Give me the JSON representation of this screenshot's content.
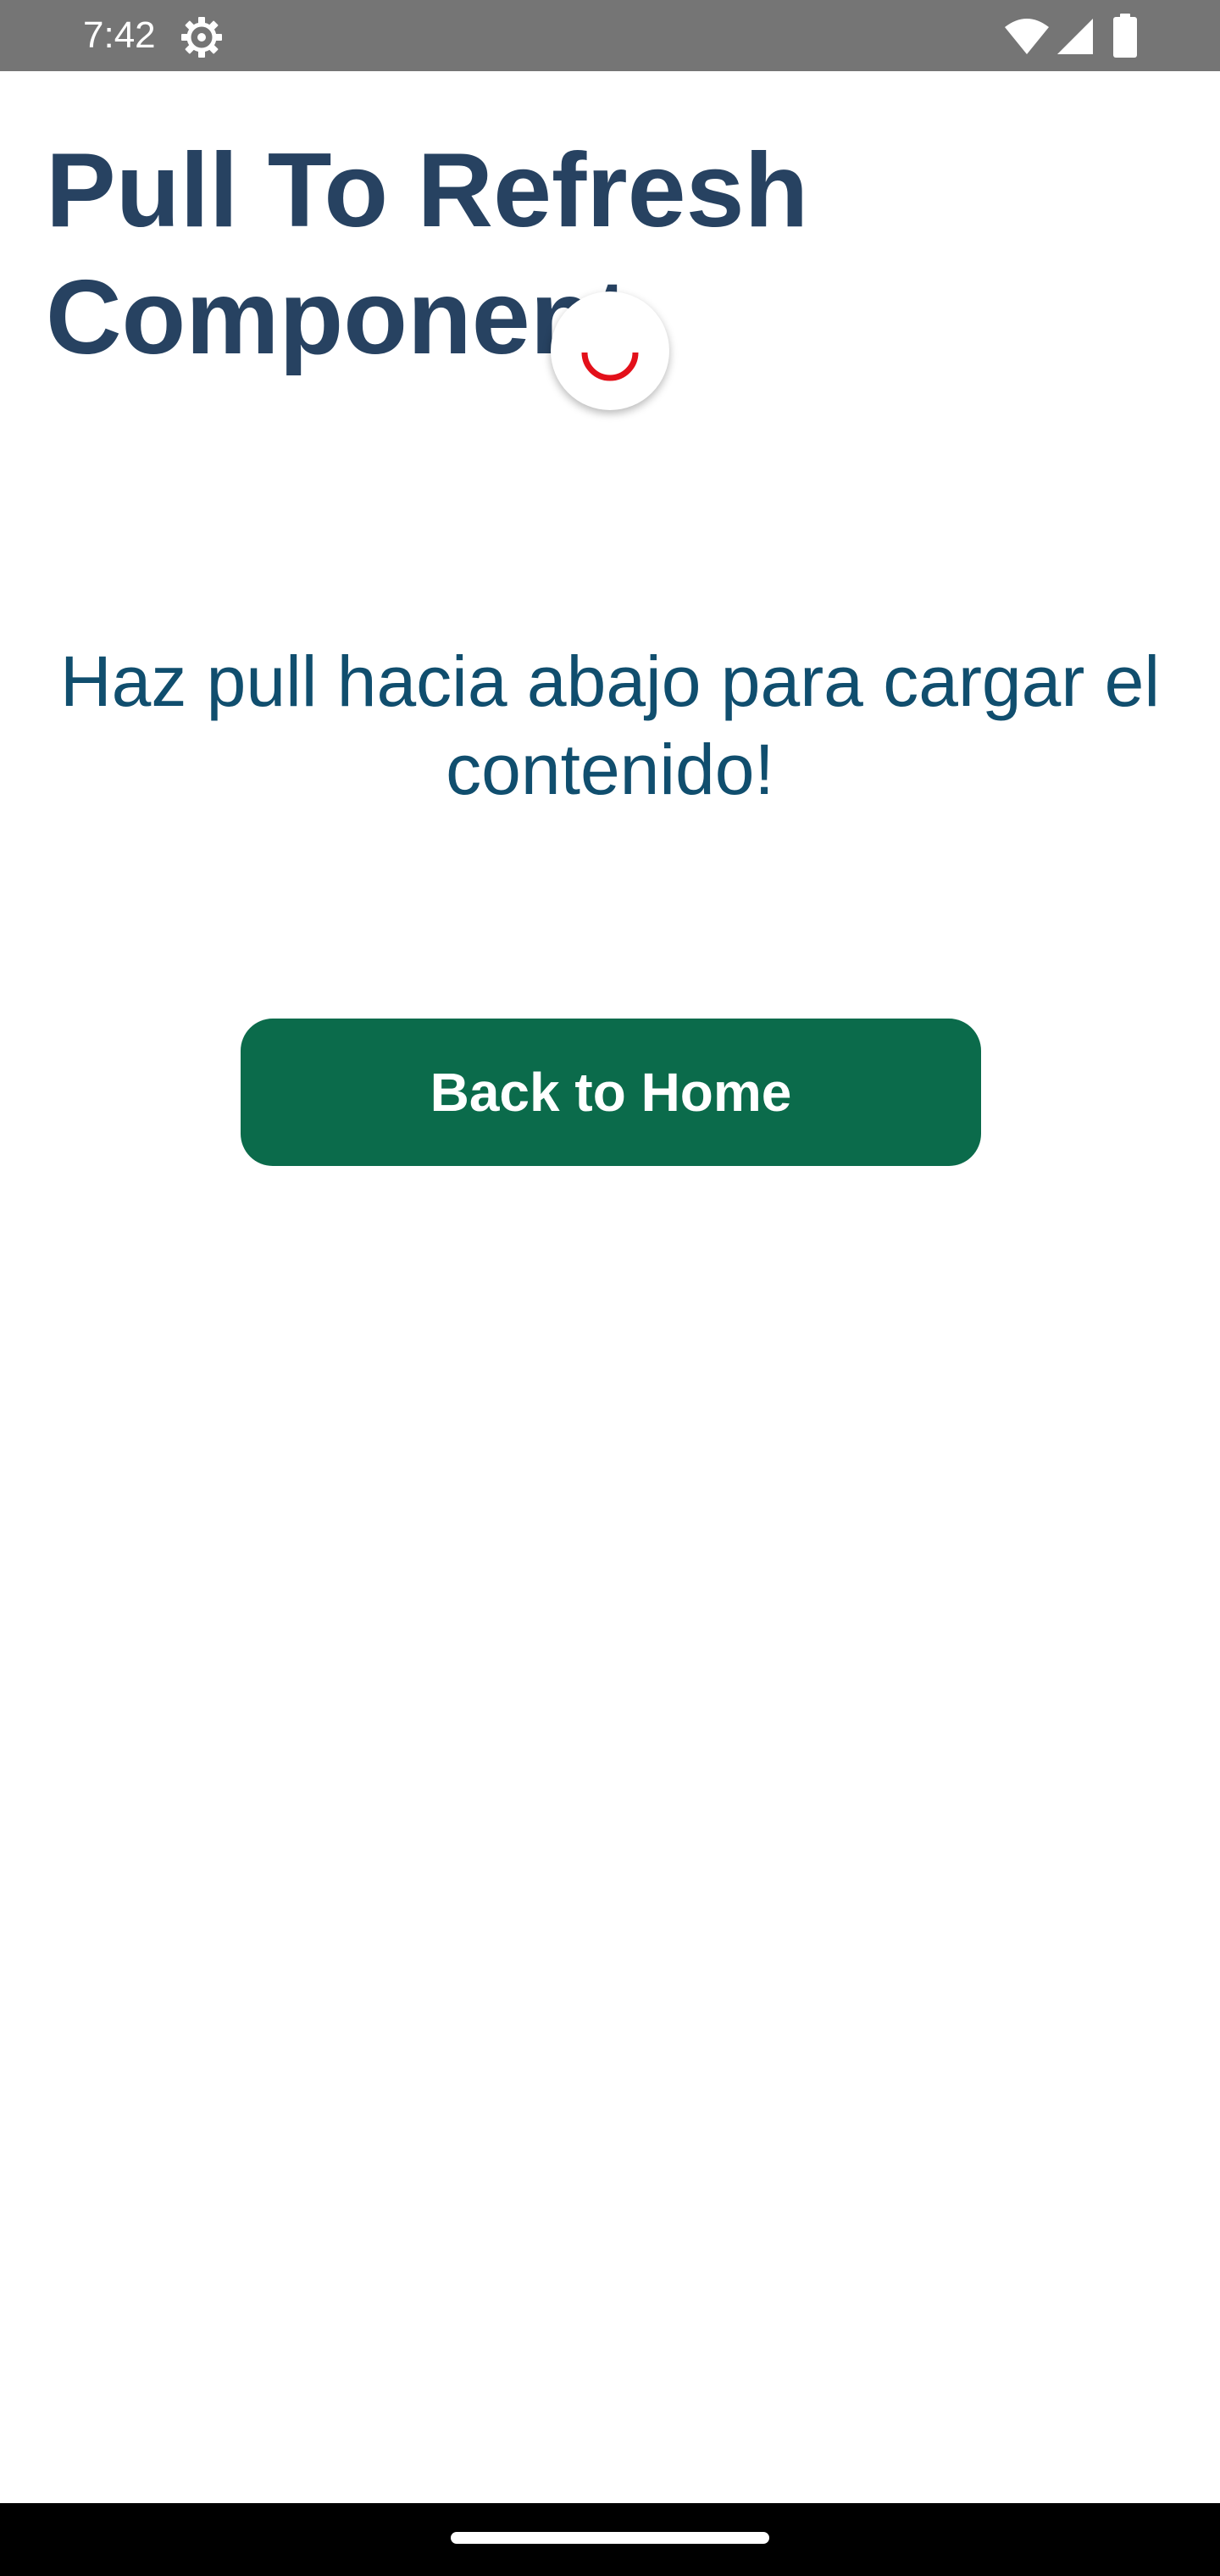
{
  "status_bar": {
    "time": "7:42",
    "icons": [
      "settings-icon",
      "wifi-icon",
      "signal-icon",
      "battery-icon"
    ]
  },
  "page": {
    "title": "Pull To Refresh Component",
    "instruction": "Haz pull hacia abajo para cargar el contenido!",
    "home_button_label": "Back to Home"
  },
  "refresh_indicator": {
    "icon": "loading-spinner-icon",
    "color": "#e3101a"
  },
  "colors": {
    "title": "#274261",
    "instruction": "#104e6e",
    "button": "#0b6b4b",
    "status_bar": "#757575"
  }
}
